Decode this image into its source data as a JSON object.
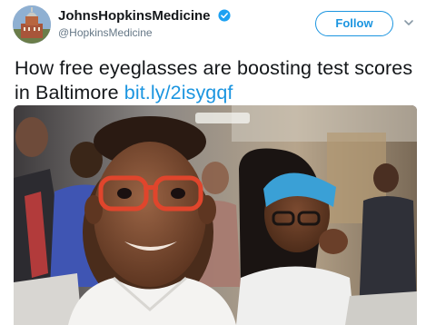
{
  "account": {
    "display_name": "JohnsHopkinsMedicine",
    "handle": "@HopkinsMedicine"
  },
  "follow_label": "Follow",
  "tweet": {
    "text": "How free eyeglasses are boosting test scores in Baltimore",
    "link": "bit.ly/2isygqf"
  },
  "colors": {
    "link_blue": "#1b95e0",
    "verified_blue": "#1da1f2",
    "text_dark": "#14171a",
    "text_muted": "#657786"
  },
  "icons": {
    "verified": "verified-badge-icon",
    "caret": "chevron-down-icon"
  }
}
